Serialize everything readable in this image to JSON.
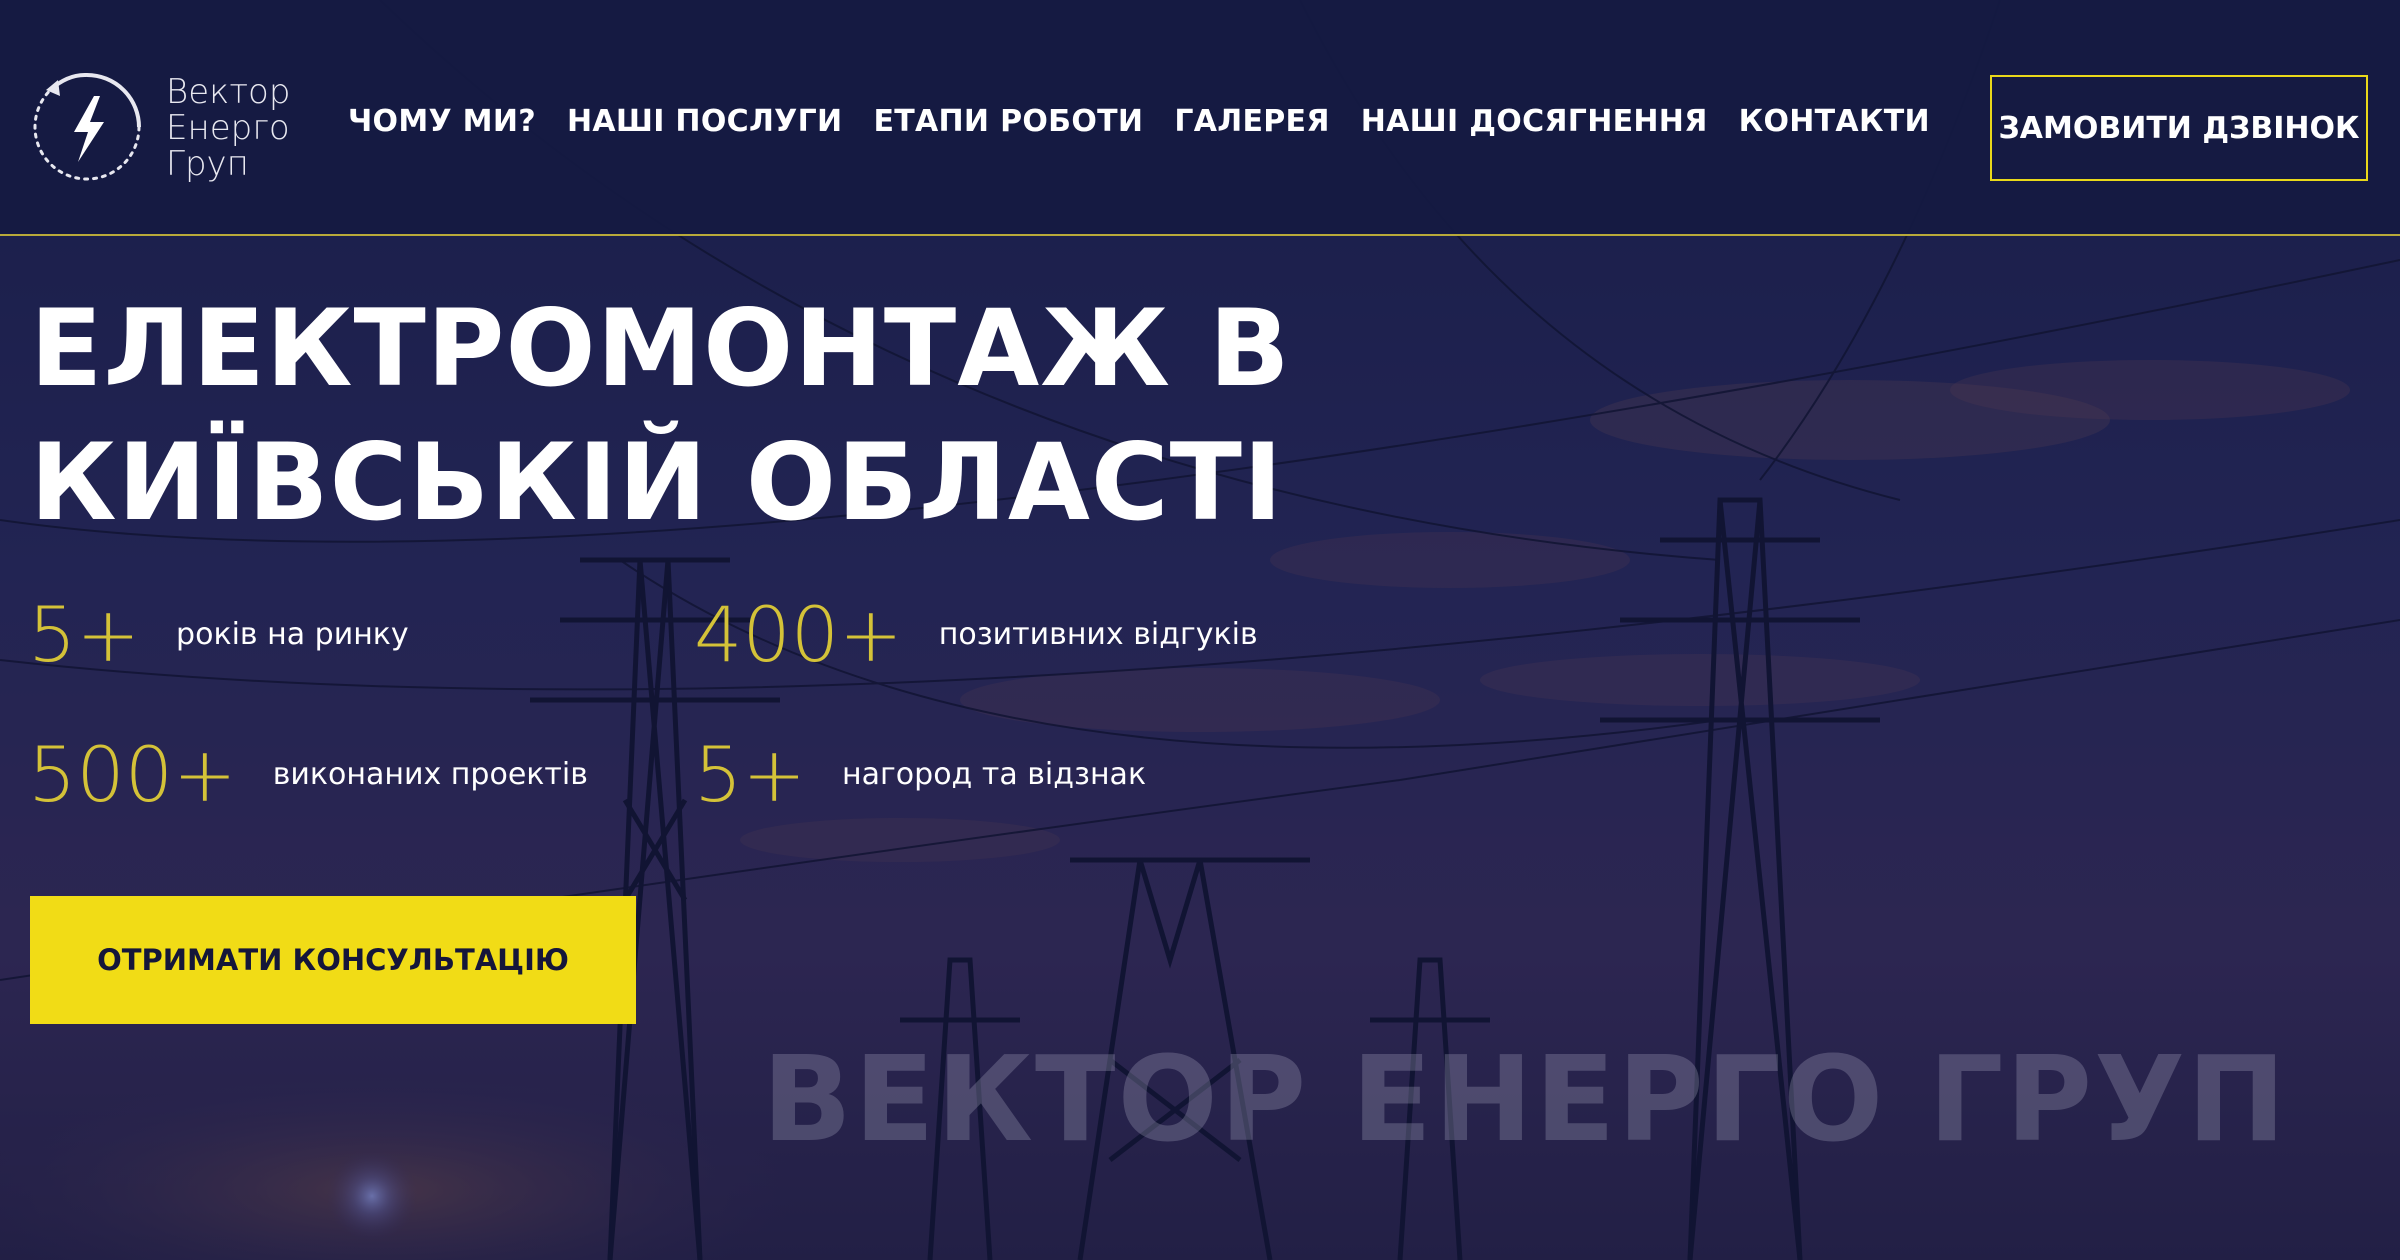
{
  "brand": {
    "name_line1": "Вектор",
    "name_line2": "Енерго",
    "name_line3": "Груп",
    "logo_icon": "lightning-circle-icon"
  },
  "nav": {
    "items": [
      {
        "label": "ЧОМУ МИ?"
      },
      {
        "label": "НАШІ ПОСЛУГИ"
      },
      {
        "label": "ЕТАПИ РОБОТИ"
      },
      {
        "label": "ГАЛЕРЕЯ"
      },
      {
        "label": "НАШІ ДОСЯГНЕННЯ"
      },
      {
        "label": "КОНТАКТИ"
      }
    ],
    "cta_label": "ЗАМОВИТИ ДЗВІНОК"
  },
  "hero": {
    "title_line1": "ЕЛЕКТРОМОНТАЖ В",
    "title_line2": "КИЇВСЬКІЙ ОБЛАСТІ",
    "stats": [
      {
        "value": "5+",
        "label": "років на ринку"
      },
      {
        "value": "400+",
        "label": "позитивних відгуків"
      },
      {
        "value": "500+",
        "label": "виконаних проектів"
      },
      {
        "value": "5+",
        "label": "нагород та відзнак"
      }
    ],
    "cta_label": "ОТРИМАТИ КОНСУЛЬТАЦІЮ",
    "watermark": "ВЕКТОР ЕНЕРГО ГРУП"
  },
  "colors": {
    "accent_yellow": "#f1dc16",
    "stat_gold": "#d4c238",
    "header_bg": "#151a42",
    "text_white": "#ffffff"
  }
}
